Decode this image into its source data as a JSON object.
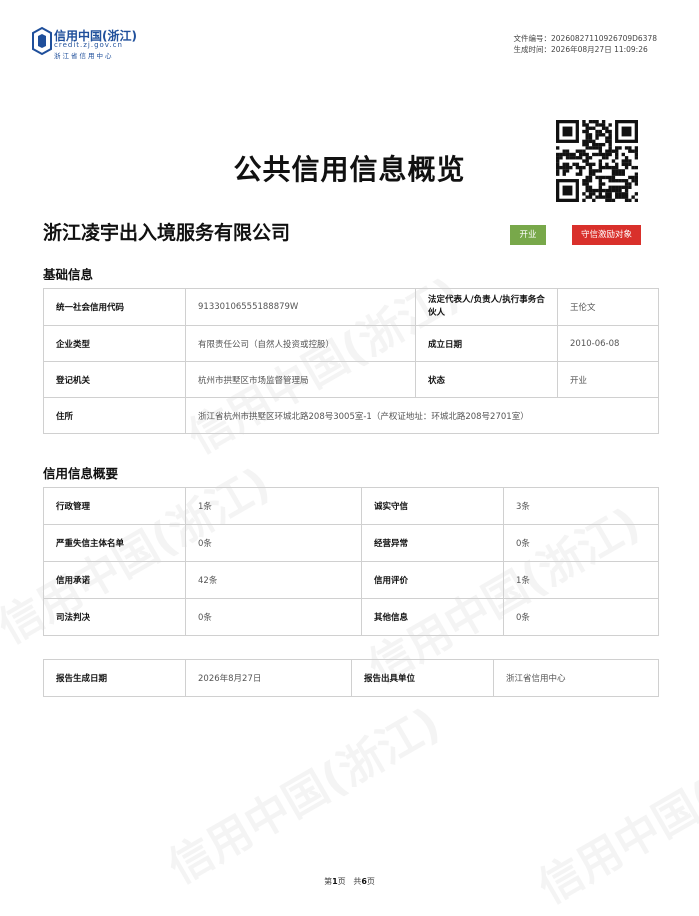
{
  "logo": {
    "title": "信用中国(浙江)",
    "url": "credit.zj.gov.cn",
    "subtitle": "浙江省信用中心"
  },
  "file_meta": {
    "number_label": "文件编号：",
    "number": "20260827110926709D6378",
    "time_label": "生成时间：",
    "time": "2026年08月27日 11:09:26"
  },
  "document_title": "公共信用信息概览",
  "company": {
    "name": "浙江凌宇出入境服务有限公司",
    "status_badge": "开业",
    "award_badge": "守信激励对象"
  },
  "basic_info": {
    "title": "基础信息",
    "credit_code_label": "统一社会信用代码",
    "credit_code": "91330106555188879W",
    "legal_rep_label": "法定代表人/负责人/执行事务合伙人",
    "legal_rep": "王伦文",
    "type_label": "企业类型",
    "type": "有限责任公司（自然人投资或控股）",
    "founded_label": "成立日期",
    "founded": "2010-06-08",
    "authority_label": "登记机关",
    "authority": "杭州市拱墅区市场监督管理局",
    "state_label": "状态",
    "state": "开业",
    "address_label": "住所",
    "address": "浙江省杭州市拱墅区环城北路208号3005室-1（产权证地址：环城北路208号2701室）"
  },
  "credit_overview": {
    "title": "信用信息概要",
    "rows": [
      {
        "k1": "行政管理",
        "v1": "1条",
        "k2": "诚实守信",
        "v2": "3条"
      },
      {
        "k1": "严重失信主体名单",
        "v1": "0条",
        "k2": "经营异常",
        "v2": "0条"
      },
      {
        "k1": "信用承诺",
        "v1": "42条",
        "k2": "信用评价",
        "v2": "1条"
      },
      {
        "k1": "司法判决",
        "v1": "0条",
        "k2": "其他信息",
        "v2": "0条"
      }
    ]
  },
  "report": {
    "date_label": "报告生成日期",
    "date": "2026年8月27日",
    "issuer_label": "报告出具单位",
    "issuer": "浙江省信用中心"
  },
  "footer": {
    "page_prefix": "第",
    "page": "1",
    "page_suffix": "页",
    "total_prefix": "共",
    "total": "6",
    "total_suffix": "页"
  },
  "colors": {
    "brand_blue": "#1f4f9b",
    "badge_green": "#78a84a",
    "badge_red": "#d9302b"
  }
}
